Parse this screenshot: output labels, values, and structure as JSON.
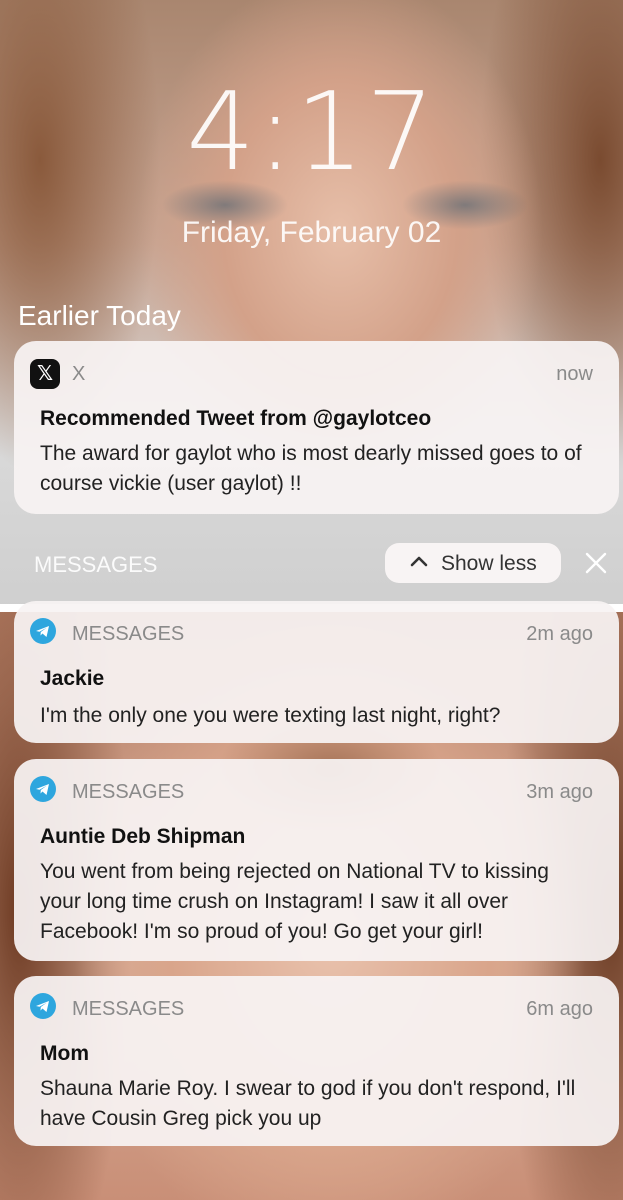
{
  "clock": {
    "time": "4:17",
    "date": "Friday, February 02"
  },
  "section": {
    "title": "Earlier Today"
  },
  "x_notification": {
    "app": "X",
    "time": "now",
    "title": "Recommended Tweet from @gaylotceo",
    "body": "The award for gaylot who is most dearly missed goes to of course vickie (user gaylot) !!"
  },
  "group": {
    "label": "MESSAGES",
    "show_less": "Show less"
  },
  "messages": [
    {
      "app": "MESSAGES",
      "time": "2m ago",
      "sender": "Jackie",
      "body": "I'm the only one you were texting last night, right?"
    },
    {
      "app": "MESSAGES",
      "time": "3m ago",
      "sender": "Auntie Deb Shipman",
      "body": "You went from being rejected on National TV to kissing your long time crush on Instagram! I saw it all over Facebook! I'm so proud of you! Go get your girl!"
    },
    {
      "app": "MESSAGES",
      "time": "6m ago",
      "sender": "Mom",
      "body": "Shauna Marie Roy. I swear to god if you don't respond, I'll have Cousin Greg pick you up"
    }
  ],
  "icons": {
    "x_app": "x-logo-icon",
    "messages_app": "telegram-icon",
    "chevron": "chevron-up-icon",
    "close": "close-icon"
  },
  "colors": {
    "telegram_blue": "#2ea6de",
    "card_bg": "#f8f3f3"
  }
}
